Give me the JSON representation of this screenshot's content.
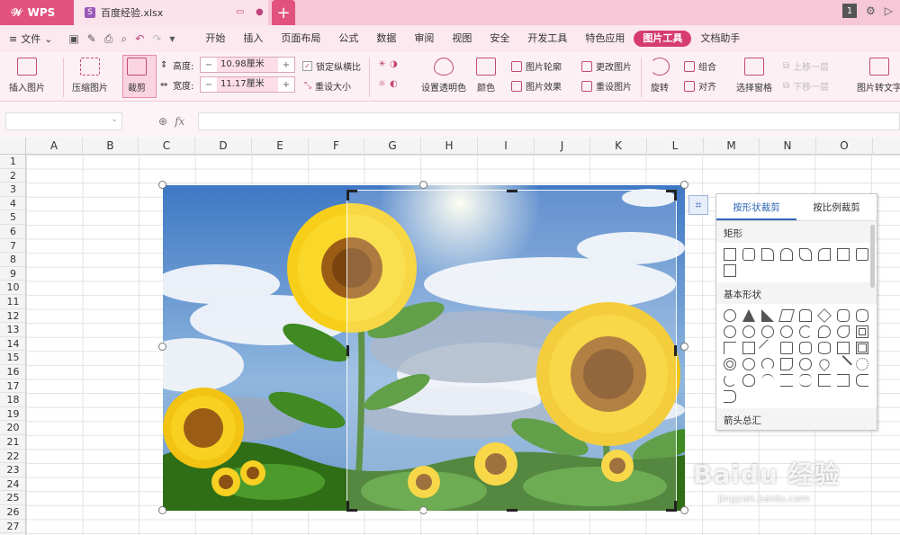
{
  "titlebar": {
    "app_name": "WPS",
    "file_name": "百度经验.xlsx",
    "window_badge": "1"
  },
  "menu": {
    "file_label": "文件",
    "tabs": [
      "开始",
      "插入",
      "页面布局",
      "公式",
      "数据",
      "审阅",
      "视图",
      "安全",
      "开发工具",
      "特色应用",
      "图片工具",
      "文档助手"
    ],
    "active_tab": "图片工具"
  },
  "ribbon": {
    "insert_picture": "插入图片",
    "compress_picture": "压缩图片",
    "crop": "裁剪",
    "height_label": "高度:",
    "height_value": "10.98厘米",
    "width_label": "宽度:",
    "width_value": "11.17厘米",
    "lock_ratio": "锁定纵横比",
    "reset_size": "重设大小",
    "set_transparent": "设置透明色",
    "color": "颜色",
    "picture_outline": "图片轮廓",
    "picture_effects": "图片效果",
    "change_picture": "更改图片",
    "reset_picture": "重设图片",
    "rotate": "旋转",
    "group": "组合",
    "align": "对齐",
    "selection_pane": "选择窗格",
    "bring_forward": "上移一层",
    "send_backward": "下移一层",
    "picture_to_text": "图片转文字"
  },
  "formula_bar": {
    "fx": "fx"
  },
  "columns": [
    "A",
    "B",
    "C",
    "D",
    "E",
    "F",
    "G",
    "H",
    "I",
    "J",
    "K",
    "L",
    "M",
    "N",
    "O"
  ],
  "rows": [
    "1",
    "2",
    "3",
    "4",
    "5",
    "6",
    "7",
    "8",
    "9",
    "10",
    "11",
    "12",
    "13",
    "14",
    "15",
    "16",
    "17",
    "18",
    "19",
    "20",
    "21",
    "22",
    "23",
    "24",
    "25",
    "26",
    "27"
  ],
  "crop_panel": {
    "tab_shape": "按形状裁剪",
    "tab_ratio": "按比例裁剪",
    "cat_rect": "矩形",
    "cat_basic": "基本形状",
    "cat_arrows": "箭头总汇"
  },
  "watermark": {
    "main": "Baidu 经验",
    "sub": "jingyan.baidu.com"
  }
}
